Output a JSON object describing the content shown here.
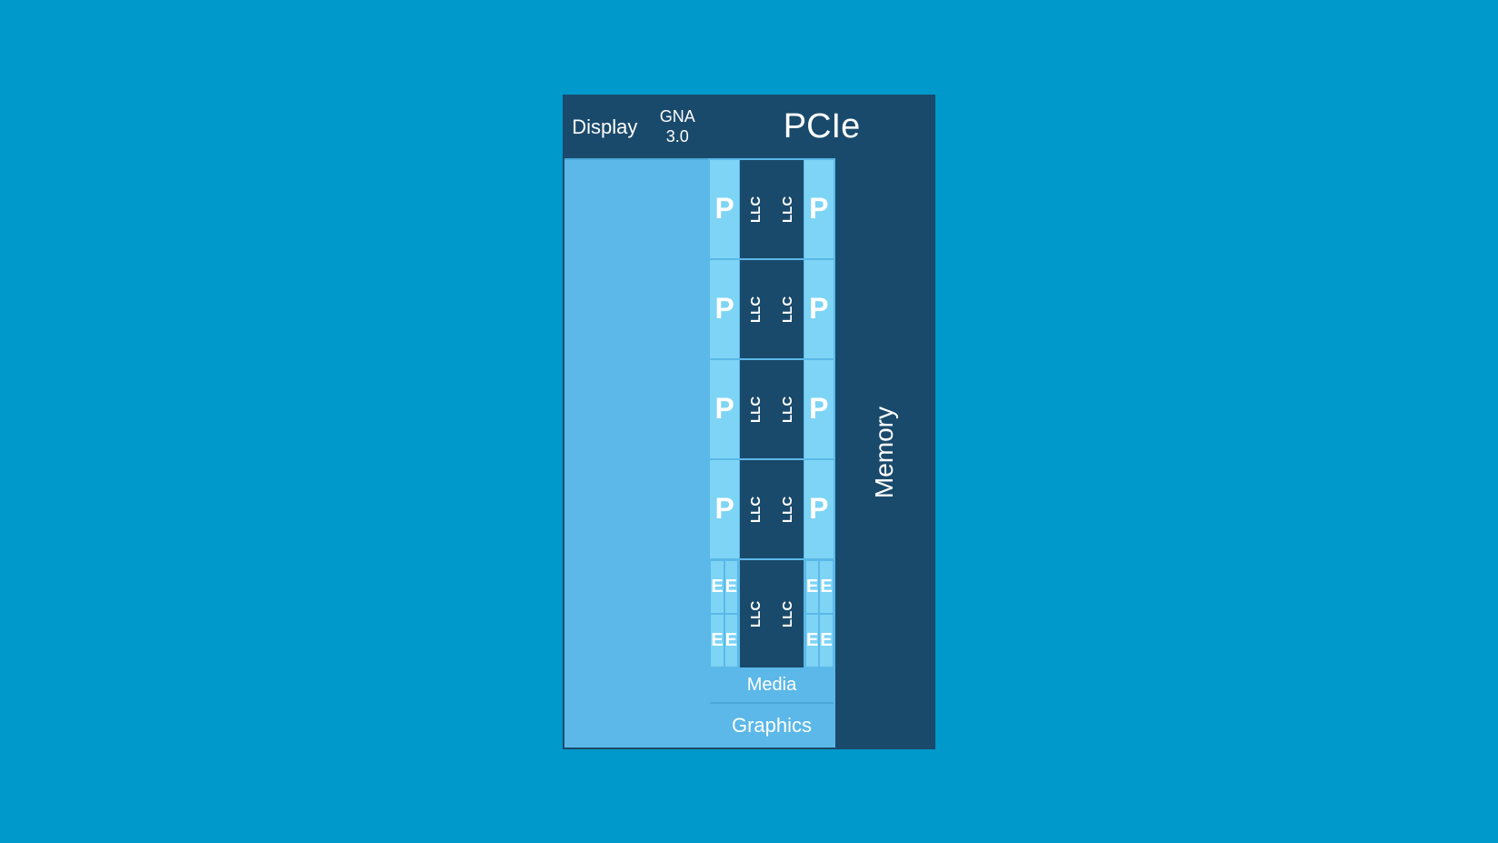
{
  "header": {
    "display_label": "Display",
    "gna_label": "GNA\n3.0",
    "pcie_label": "PCIe"
  },
  "cores": {
    "p_label": "P",
    "llc_label": "LLC",
    "e_label": "E",
    "p_rows": 4,
    "e_clusters": 2
  },
  "bottom": {
    "media_label": "Media",
    "graphics_label": "Graphics"
  },
  "memory": {
    "label": "Memory"
  }
}
